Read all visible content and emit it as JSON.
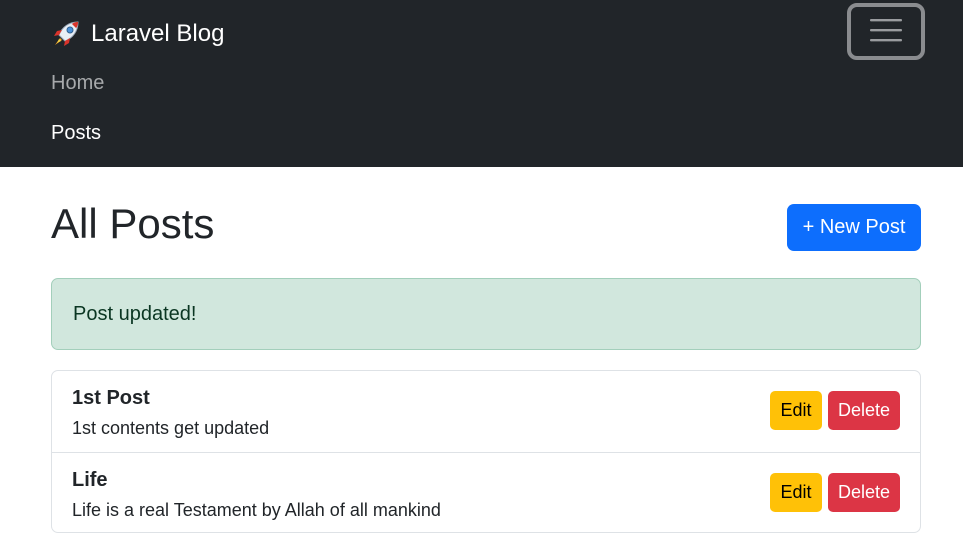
{
  "navbar": {
    "brand_label": "Laravel Blog",
    "brand_icon": "rocket-icon",
    "toggler_icon": "hamburger-icon",
    "links": [
      {
        "label": "Home"
      },
      {
        "label": "Posts"
      }
    ]
  },
  "main": {
    "title": "All Posts",
    "new_post_label": "+ New Post",
    "alert_text": "Post updated!",
    "posts": [
      {
        "title": "1st Post",
        "body": "1st contents get updated",
        "edit_label": "Edit",
        "delete_label": "Delete"
      },
      {
        "title": "Life",
        "body": "Life is a real Testament by Allah of all mankind",
        "edit_label": "Edit",
        "delete_label": "Delete"
      }
    ]
  },
  "colors": {
    "navbar_bg": "#212529",
    "primary": "#0d6efd",
    "alert_success_bg": "#d1e7dd",
    "warning": "#ffc107",
    "danger": "#dc3545"
  }
}
